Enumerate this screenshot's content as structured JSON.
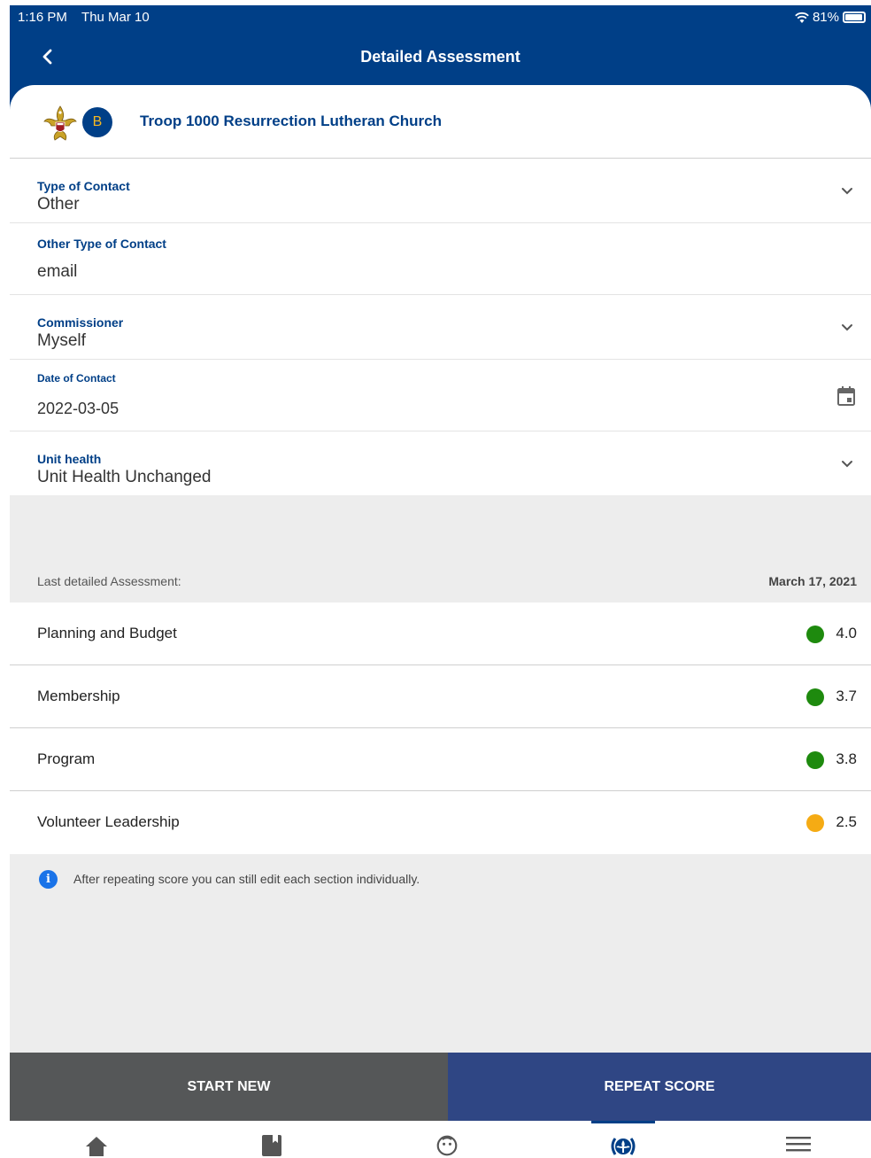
{
  "status_bar": {
    "time": "1:16 PM",
    "date": "Thu Mar 10",
    "battery": "81%"
  },
  "nav": {
    "title": "Detailed Assessment",
    "back_icon": "chevron-left-icon"
  },
  "unit": {
    "badge": "B",
    "name": "Troop 1000 Resurrection Lutheran Church"
  },
  "fields": {
    "type_of_contact": {
      "label": "Type of Contact",
      "value": "Other"
    },
    "other_type": {
      "label": "Other Type of Contact",
      "value": "email"
    },
    "commissioner": {
      "label": "Commissioner",
      "value": "Myself"
    },
    "date_of_contact": {
      "label": "Date of Contact",
      "value": "2022-03-05"
    },
    "unit_health": {
      "label": "Unit health",
      "value": "Unit Health Unchanged"
    }
  },
  "last_assessment": {
    "label": "Last detailed Assessment:",
    "date": "March 17, 2021"
  },
  "scores": [
    {
      "name": "Planning and Budget",
      "value": "4.0",
      "color": "#1e8a0e"
    },
    {
      "name": "Membership",
      "value": "3.7",
      "color": "#1e8a0e"
    },
    {
      "name": "Program",
      "value": "3.8",
      "color": "#1e8a0e"
    },
    {
      "name": "Volunteer Leadership",
      "value": "2.5",
      "color": "#f5ab14"
    }
  ],
  "info": {
    "text": "After repeating score you can still edit each section individually."
  },
  "actions": {
    "start_new": "START NEW",
    "repeat_score": "REPEAT SCORE"
  },
  "tabbar": {
    "items": [
      "home-icon",
      "book-icon",
      "face-icon",
      "fleur-de-lis-icon",
      "menu-icon"
    ],
    "active": "fleur-de-lis-icon"
  },
  "colors": {
    "primary": "#003f87",
    "repeat_button": "#2f4684",
    "start_button": "#555758"
  }
}
